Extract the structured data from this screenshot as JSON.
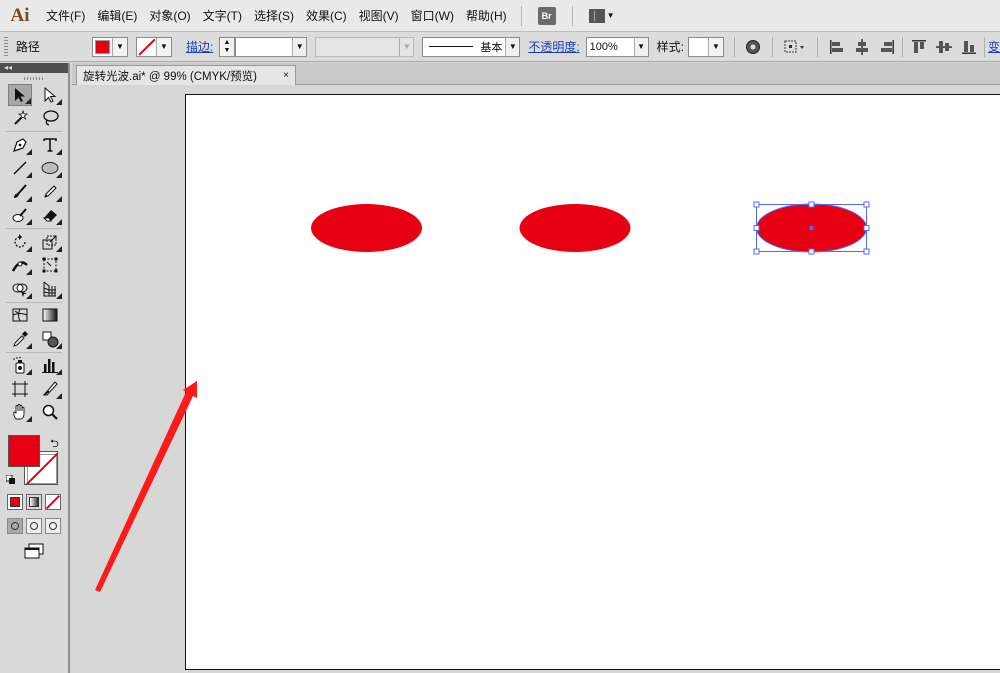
{
  "app": {
    "logo": "Ai",
    "bridge_label": "Br"
  },
  "menu": [
    "文件(F)",
    "编辑(E)",
    "对象(O)",
    "文字(T)",
    "选择(S)",
    "效果(C)",
    "视图(V)",
    "窗口(W)",
    "帮助(H)"
  ],
  "control": {
    "selection_label": "路径",
    "stroke_label": "描边:",
    "stroke_style": "基本",
    "opacity_label": "不透明度:",
    "opacity_value": "100%",
    "style_label": "样式:",
    "transform_label": "变"
  },
  "document": {
    "tab_title": "旋转光波.ai* @ 99% (CMYK/预览)",
    "close_label": "×"
  },
  "colors": {
    "fill": "#e60012",
    "selection": "#4f6cf5",
    "annotation_arrow": "#ff1a1a"
  },
  "canvas": {
    "objects": [
      {
        "type": "ellipse",
        "fill": "#e60012",
        "selected": false
      },
      {
        "type": "ellipse",
        "fill": "#e60012",
        "selected": false
      },
      {
        "type": "ellipse",
        "fill": "#e60012",
        "selected": true
      }
    ]
  },
  "tools": [
    [
      "selection-tool",
      "direct-selection-tool"
    ],
    [
      "magic-wand-tool",
      "lasso-tool"
    ],
    [
      "pen-tool",
      "type-tool"
    ],
    [
      "line-segment-tool",
      "ellipse-tool"
    ],
    [
      "paintbrush-tool",
      "pencil-tool"
    ],
    [
      "blob-brush-tool",
      "eraser-tool"
    ],
    [
      "rotate-tool",
      "scale-tool"
    ],
    [
      "width-tool",
      "free-transform-tool"
    ],
    [
      "shape-builder-tool",
      "perspective-grid-tool"
    ],
    [
      "mesh-tool",
      "gradient-tool"
    ],
    [
      "eyedropper-tool",
      "blend-tool"
    ],
    [
      "symbol-sprayer-tool",
      "column-graph-tool"
    ],
    [
      "artboard-tool",
      "slice-tool"
    ],
    [
      "hand-tool",
      "zoom-tool"
    ]
  ]
}
